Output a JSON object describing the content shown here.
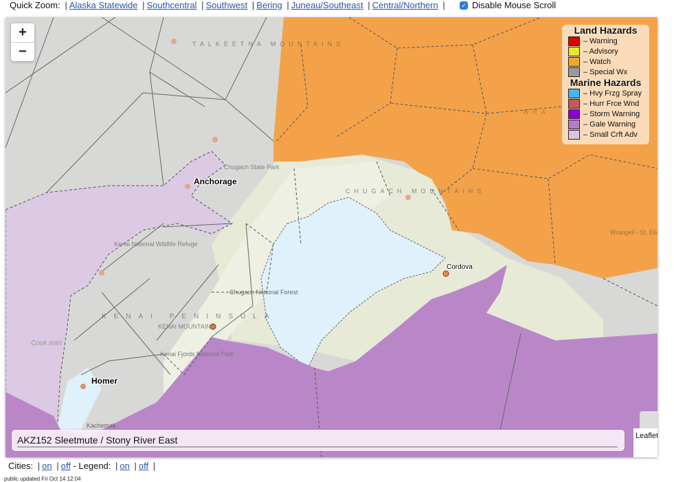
{
  "header": {
    "quick_zoom_label": "Quick Zoom:",
    "links": [
      "Alaska Statewide",
      "Southcentral",
      "Southwest",
      "Bering",
      "Juneau/Southeast",
      "Central/Northern"
    ],
    "disable_scroll_label": "Disable Mouse Scroll",
    "disable_scroll_checked": true
  },
  "map": {
    "zoom_in": "+",
    "zoom_out": "−",
    "cities": [
      "Anchorage",
      "Homer",
      "Cordova"
    ],
    "place_labels": {
      "talkeetna": "TALKEETNA MOUNTAINS",
      "chugach": "CHUGACH MOUNTAINS",
      "kenai_peninsula": "KENAI PENINSULA",
      "kenai_mountains": "KENAI MOUNTAINS",
      "kenai_refuge": "Kenai National Wildlife Refuge",
      "chugach_forest": "Chugach National Forest",
      "chugach_state": "Chugach State Park",
      "kenai_fjords": "Kenai Fjords National Park",
      "cook_inlet": "Cook Inlet",
      "kachemak": "Kachemak",
      "wrangell": "Wrangell - St. Elias National Park",
      "wrangell_mtns": "WRA"
    },
    "legend": {
      "land_title": "Land Hazards",
      "land": [
        {
          "label": "– Warning",
          "color": "#e00000"
        },
        {
          "label": "– Advisory",
          "color": "#e8e82a"
        },
        {
          "label": "– Watch",
          "color": "#f5a623"
        },
        {
          "label": "– Special Wx",
          "color": "#9a9a9a"
        }
      ],
      "marine_title": "Marine Hazards",
      "marine": [
        {
          "label": "– Hvy Frzg Spray",
          "color": "#3fb8f5"
        },
        {
          "label": "– Hurr Frce Wnd",
          "color": "#c8585a"
        },
        {
          "label": "– Storm Warning",
          "color": "#8e00d8"
        },
        {
          "label": "– Gale Warning",
          "color": "#b67cc8"
        },
        {
          "label": "– Small Crft Adv",
          "color": "#d9c4e2"
        }
      ]
    },
    "info_zone": "AKZ152 Sleetmute / Stony River East",
    "attribution": "Leaflet"
  },
  "footer": {
    "cities_label": "Cities:",
    "legend_label": "- Legend:",
    "on": "on",
    "off": "off",
    "updated": "public updated Fri Oct 14 12:04"
  }
}
